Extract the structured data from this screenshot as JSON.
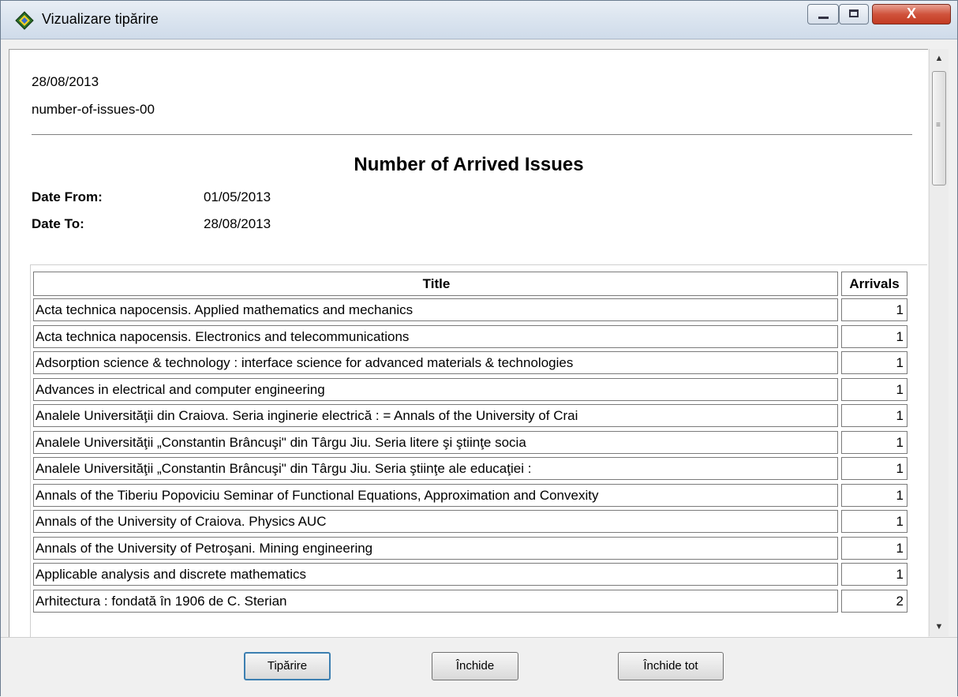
{
  "window": {
    "title": "Vizualizare tipărire",
    "controls": {
      "minimize_icon": "minimize-icon",
      "maximize_icon": "maximize-icon",
      "close_icon": "close-icon",
      "close_glyph": "X"
    }
  },
  "report": {
    "date": "28/08/2013",
    "name": "number-of-issues-00",
    "title": "Number of Arrived Issues",
    "date_from_label": "Date From:",
    "date_from": "01/05/2013",
    "date_to_label": "Date To:",
    "date_to": "28/08/2013",
    "table": {
      "headers": [
        "Title",
        "Arrivals"
      ],
      "rows": [
        [
          "Acta technica napocensis. Applied mathematics and mechanics",
          "1"
        ],
        [
          "Acta technica napocensis. Electronics and telecommunications",
          "1"
        ],
        [
          "Adsorption science & technology : interface science for advanced materials & technologies",
          "1"
        ],
        [
          "Advances in electrical and computer engineering",
          "1"
        ],
        [
          "Analele Universităţii din Craiova. Seria inginerie electrică : = Annals of the University of Crai",
          "1"
        ],
        [
          "Analele Universităţii „Constantin Brâncuşi\" din Târgu Jiu. Seria litere şi ştiinţe socia",
          "1"
        ],
        [
          "Analele Universităţii „Constantin Brâncuşi\" din Târgu Jiu. Seria ştiinţe ale educaţiei :",
          "1"
        ],
        [
          "Annals of the Tiberiu Popoviciu Seminar of Functional Equations, Approximation and Convexity",
          "1"
        ],
        [
          "Annals of the University of Craiova. Physics AUC",
          "1"
        ],
        [
          "Annals of the University of Petroşani. Mining engineering",
          "1"
        ],
        [
          "Applicable analysis and discrete mathematics",
          "1"
        ],
        [
          "Arhitectura : fondată în 1906 de C. Sterian",
          "2"
        ]
      ]
    }
  },
  "buttons": {
    "print": "Tipărire",
    "close": "Închide",
    "close_all": "Închide tot"
  },
  "scrollbar": {
    "up_icon": "scroll-up-arrow-icon",
    "down_icon": "scroll-down-arrow-icon"
  }
}
